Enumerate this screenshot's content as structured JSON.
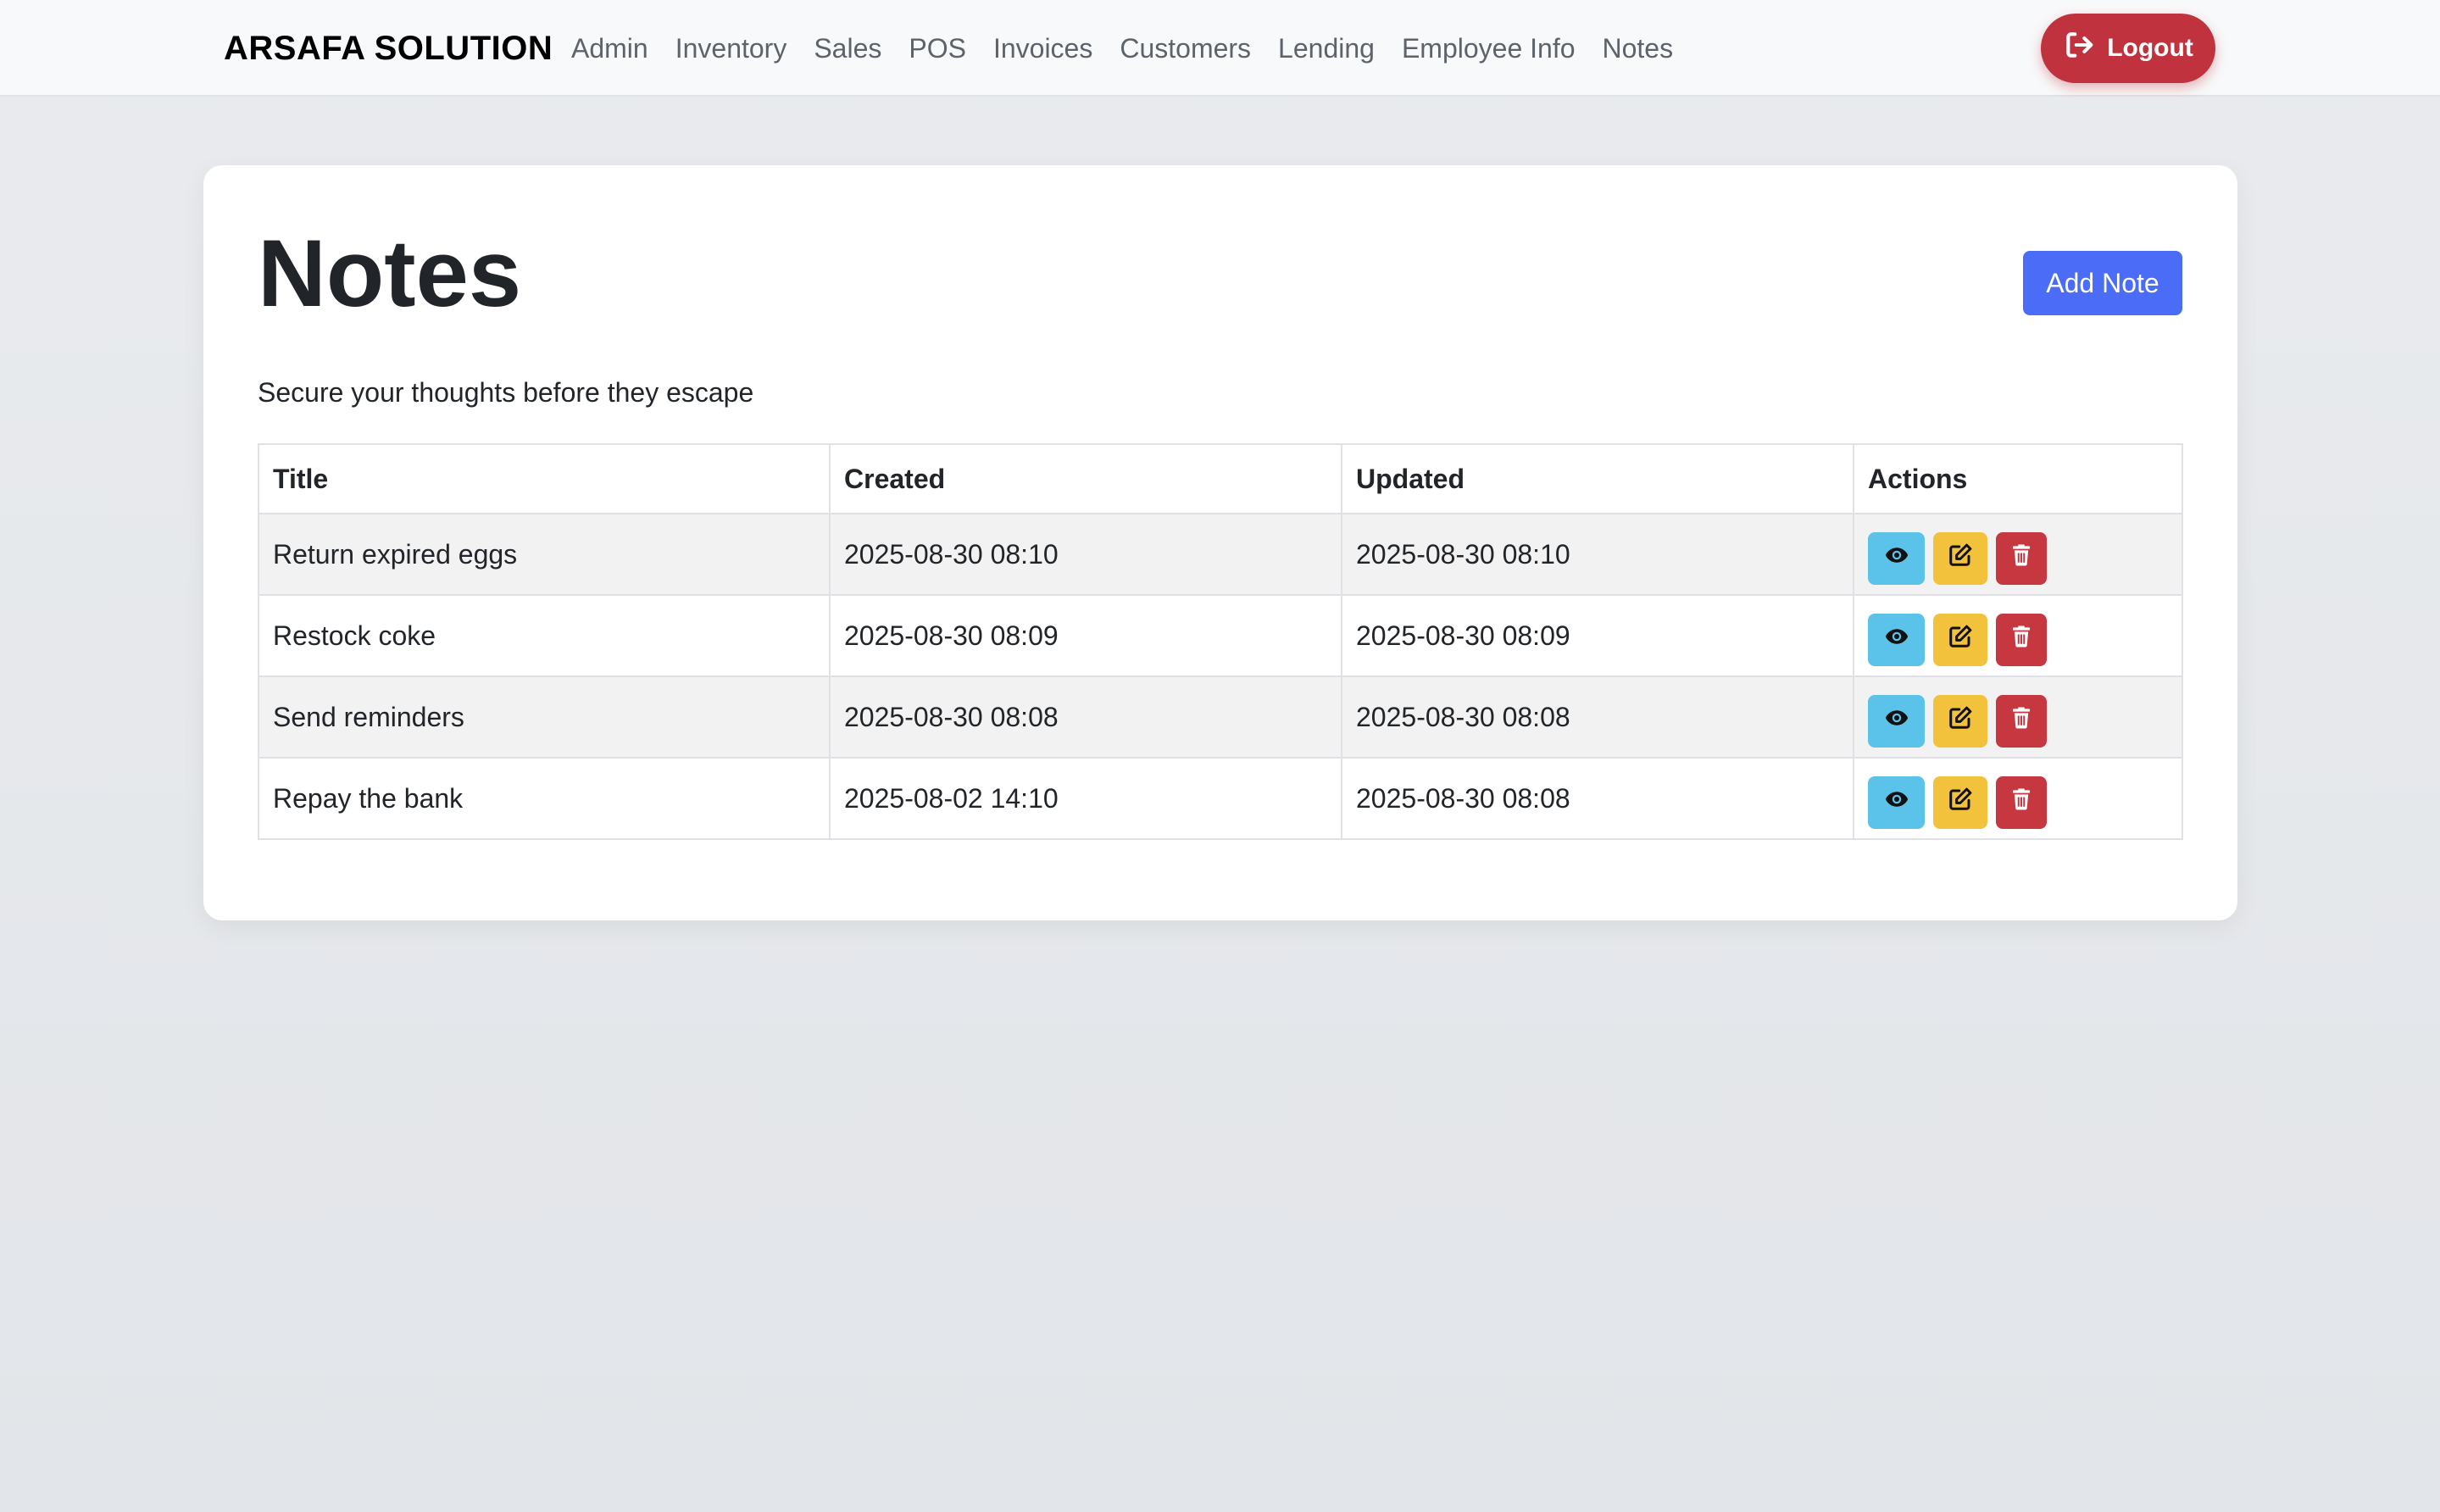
{
  "navbar": {
    "brand": "ARSAFA SOLUTION",
    "links": [
      {
        "label": "Admin"
      },
      {
        "label": "Inventory"
      },
      {
        "label": "Sales"
      },
      {
        "label": "POS"
      },
      {
        "label": "Invoices"
      },
      {
        "label": "Customers"
      },
      {
        "label": "Lending"
      },
      {
        "label": "Employee Info"
      },
      {
        "label": "Notes"
      }
    ],
    "logout_label": "Logout",
    "logout_icon": "sign-out-icon"
  },
  "main": {
    "title": "Notes",
    "subtitle": "Secure your thoughts before they escape",
    "add_button_label": "Add Note"
  },
  "table": {
    "headers": {
      "title": "Title",
      "created": "Created",
      "updated": "Updated",
      "actions": "Actions"
    },
    "rows": [
      {
        "title": "Return expired eggs",
        "created": "2025-08-30 08:10",
        "updated": "2025-08-30 08:10"
      },
      {
        "title": "Restock coke",
        "created": "2025-08-30 08:09",
        "updated": "2025-08-30 08:09"
      },
      {
        "title": "Send reminders",
        "created": "2025-08-30 08:08",
        "updated": "2025-08-30 08:08"
      },
      {
        "title": "Repay the bank",
        "created": "2025-08-02 14:10",
        "updated": "2025-08-30 08:08"
      }
    ],
    "action_icons": [
      "eye-icon",
      "edit-icon",
      "trash-icon"
    ]
  },
  "colors": {
    "primary": "#4a6cf7",
    "danger": "#c0323d",
    "info": "#5bc2ea",
    "warning": "#f2c23d"
  }
}
